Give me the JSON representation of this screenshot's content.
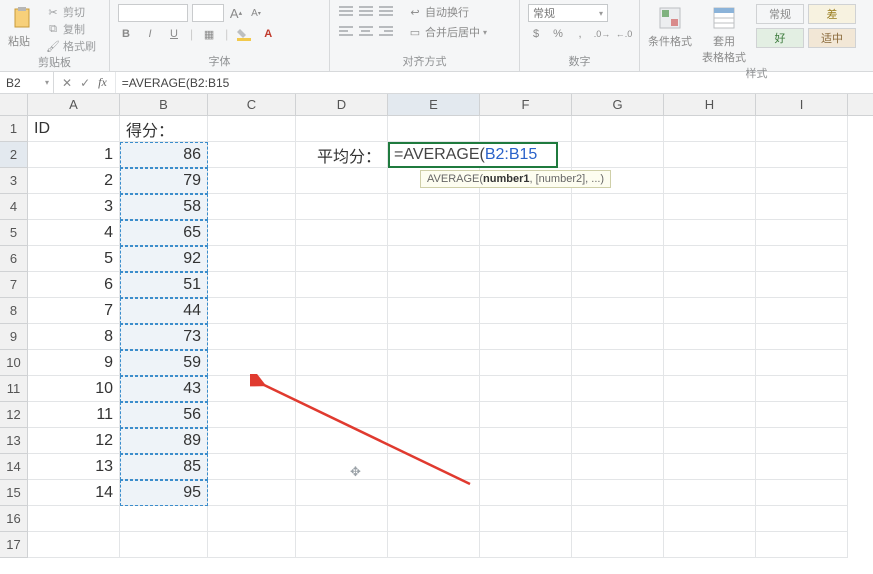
{
  "ribbon": {
    "clipboard": {
      "paste": "粘贴",
      "cut": "剪切",
      "copy": "复制",
      "fmtpaint": "格式刷",
      "label": "剪贴板"
    },
    "font": {
      "bold": "B",
      "italic": "I",
      "underline": "U",
      "growA": "A",
      "shrinkA": "A",
      "label": "字体"
    },
    "align": {
      "wrap": "自动换行",
      "merge": "合并后居中",
      "label": "对齐方式"
    },
    "number": {
      "format": "常规",
      "label": "数字"
    },
    "styles": {
      "condfmt": "条件格式",
      "tablefmt": "套用\n表格格式",
      "normal": "常规",
      "good": "好",
      "bad": "差",
      "neutral": "适中",
      "label": "样式"
    }
  },
  "formulaBar": {
    "nameBox": "B2",
    "formula": "=AVERAGE(B2:B15"
  },
  "headers": {
    "row1": {
      "A": "ID",
      "B": "得分："
    },
    "D2": "平均分："
  },
  "editCell": {
    "prefix": "=AVERAGE(",
    "ref": "B2:B15"
  },
  "tooltip": {
    "fn": "AVERAGE",
    "arg1": "number1",
    "rest": ", [number2], ...)"
  },
  "columns": [
    "A",
    "B",
    "C",
    "D",
    "E",
    "F",
    "G",
    "H",
    "I"
  ],
  "rowNumbers": [
    1,
    2,
    3,
    4,
    5,
    6,
    7,
    8,
    9,
    10,
    11,
    12,
    13,
    14,
    15,
    16,
    17
  ],
  "data": [
    {
      "id": 1,
      "score": 86
    },
    {
      "id": 2,
      "score": 79
    },
    {
      "id": 3,
      "score": 58
    },
    {
      "id": 4,
      "score": 65
    },
    {
      "id": 5,
      "score": 92
    },
    {
      "id": 6,
      "score": 51
    },
    {
      "id": 7,
      "score": 44
    },
    {
      "id": 8,
      "score": 73
    },
    {
      "id": 9,
      "score": 59
    },
    {
      "id": 10,
      "score": 43
    },
    {
      "id": 11,
      "score": 56
    },
    {
      "id": 12,
      "score": 89
    },
    {
      "id": 13,
      "score": 85
    },
    {
      "id": 14,
      "score": 95
    }
  ],
  "chart_data": {
    "type": "table",
    "title": "得分",
    "columns": [
      "ID",
      "得分"
    ],
    "rows": [
      [
        1,
        86
      ],
      [
        2,
        79
      ],
      [
        3,
        58
      ],
      [
        4,
        65
      ],
      [
        5,
        92
      ],
      [
        6,
        51
      ],
      [
        7,
        44
      ],
      [
        8,
        73
      ],
      [
        9,
        59
      ],
      [
        10,
        43
      ],
      [
        11,
        56
      ],
      [
        12,
        89
      ],
      [
        13,
        85
      ],
      [
        14,
        95
      ]
    ]
  }
}
